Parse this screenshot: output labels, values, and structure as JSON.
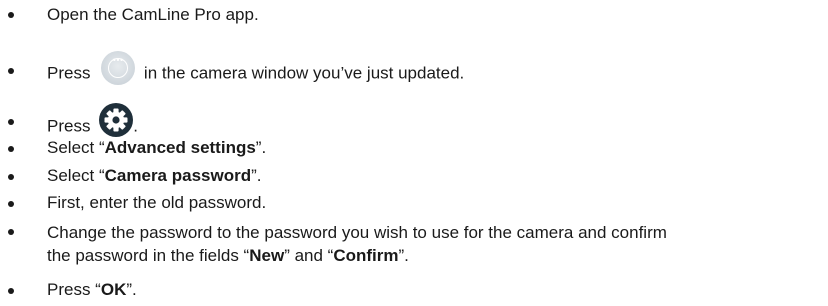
{
  "steps": [
    {
      "text": "Open the CamLine Pro app."
    },
    {
      "before": "Press ",
      "icon": "more-options-icon",
      "after": " in the camera window you’ve just updated."
    },
    {
      "before": "Press ",
      "icon": "gear-icon",
      "after": "."
    },
    {
      "before": "Select “",
      "bold": "Advanced settings",
      "after": "”."
    },
    {
      "before": "Select “",
      "bold": "Camera password",
      "after": "”."
    },
    {
      "text": "First, enter the old password."
    },
    {
      "line1": "Change the password to the password you wish to use for the camera and confirm",
      "line2_before": "the password in the fields “",
      "bold1": "New",
      "middle": "” and “",
      "bold2": "Confirm",
      "line2_after": "”."
    },
    {
      "before": "Press “",
      "bold": "OK",
      "after": "”."
    }
  ],
  "colors": {
    "text": "#1a1a1a",
    "menu_button": "#cfd6dc",
    "gear": "#1f2f3a"
  }
}
